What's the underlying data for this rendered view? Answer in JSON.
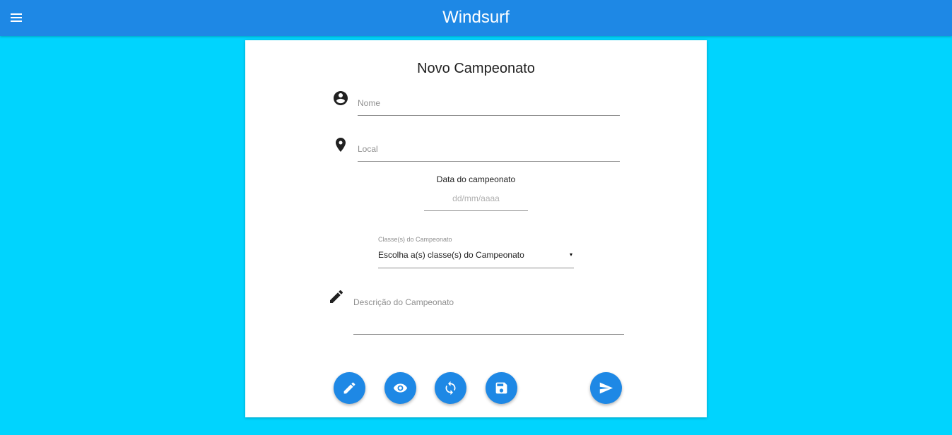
{
  "app": {
    "title": "Windsurf",
    "menu_icon": "hamburger-menu-icon",
    "bar_color": "#1e88e5",
    "background_color": "#00d4fe"
  },
  "form": {
    "title": "Novo Campeonato",
    "nome": {
      "icon": "account-circle-icon",
      "placeholder": "Nome",
      "value": ""
    },
    "local": {
      "icon": "location-pin-icon",
      "placeholder": "Local",
      "value": ""
    },
    "data": {
      "label": "Data do campeonato",
      "placeholder": "dd/mm/aaaa",
      "value": ""
    },
    "classes": {
      "label": "Classe(s) do Campeonato",
      "selected": "Escolha a(s) classe(s) do Campeonato",
      "caret": "▾"
    },
    "descricao": {
      "icon": "pencil-icon",
      "placeholder": "Descrição do Campeonato",
      "value": ""
    }
  },
  "actions": [
    {
      "icon": "edit-icon"
    },
    {
      "icon": "preview-eye-icon"
    },
    {
      "icon": "refresh-icon"
    },
    {
      "icon": "save-floppy-icon"
    },
    {
      "icon": "send-icon"
    }
  ]
}
